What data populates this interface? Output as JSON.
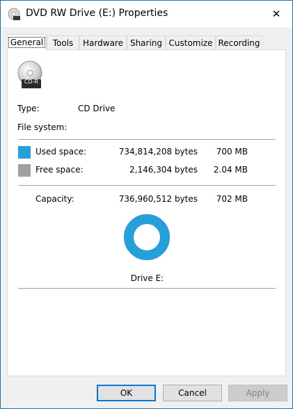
{
  "window": {
    "title": "DVD RW Drive (E:) Properties",
    "close_glyph": "✕"
  },
  "tabs": [
    {
      "label": "General",
      "active": true
    },
    {
      "label": "Tools"
    },
    {
      "label": "Hardware"
    },
    {
      "label": "Sharing"
    },
    {
      "label": "Customize"
    },
    {
      "label": "Recording"
    }
  ],
  "general": {
    "disc_label": "CD-R",
    "type_label": "Type:",
    "type_value": "CD Drive",
    "filesystem_label": "File system:",
    "filesystem_value": "",
    "used": {
      "label": "Used space:",
      "bytes": "734,814,208 bytes",
      "size": "700 MB",
      "color": "#26a0da"
    },
    "free": {
      "label": "Free space:",
      "bytes": "2,146,304 bytes",
      "size": "2.04 MB",
      "color": "#a0a0a0"
    },
    "capacity": {
      "label": "Capacity:",
      "bytes": "736,960,512 bytes",
      "size": "702 MB"
    },
    "used_fraction": 0.9971,
    "drive_label": "Drive E:"
  },
  "buttons": {
    "ok": "OK",
    "cancel": "Cancel",
    "apply": "Apply"
  }
}
